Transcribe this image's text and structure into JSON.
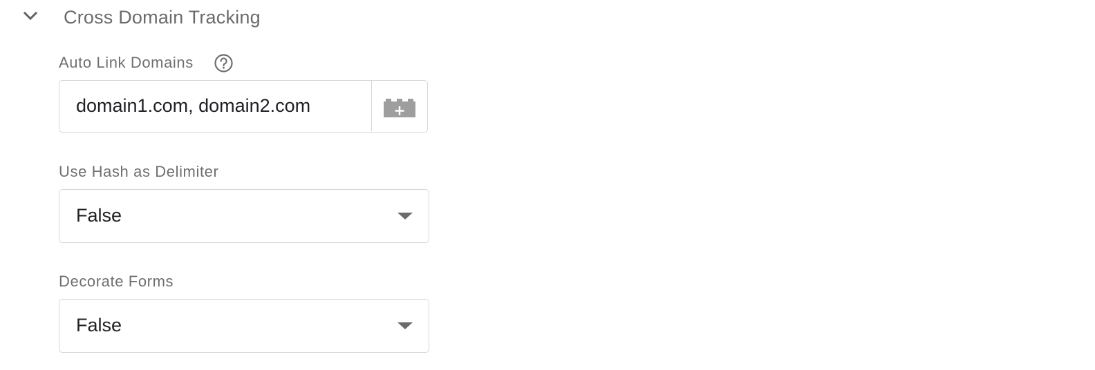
{
  "section": {
    "title": "Cross Domain Tracking",
    "chevron_icon": "chevron-down-icon"
  },
  "auto_link": {
    "label": "Auto Link Domains",
    "help_icon": "help-circle-icon",
    "value": "domain1.com, domain2.com",
    "variable_icon": "add-variable-icon"
  },
  "use_hash": {
    "label": "Use Hash as Delimiter",
    "value": "False",
    "arrow_icon": "dropdown-arrow-icon"
  },
  "decorate_forms": {
    "label": "Decorate Forms",
    "value": "False",
    "arrow_icon": "dropdown-arrow-icon"
  },
  "colors": {
    "label_gray": "#6f6f6f",
    "border": "#d6d6d6",
    "icon_gray": "#9e9e9e",
    "text": "#202124"
  }
}
